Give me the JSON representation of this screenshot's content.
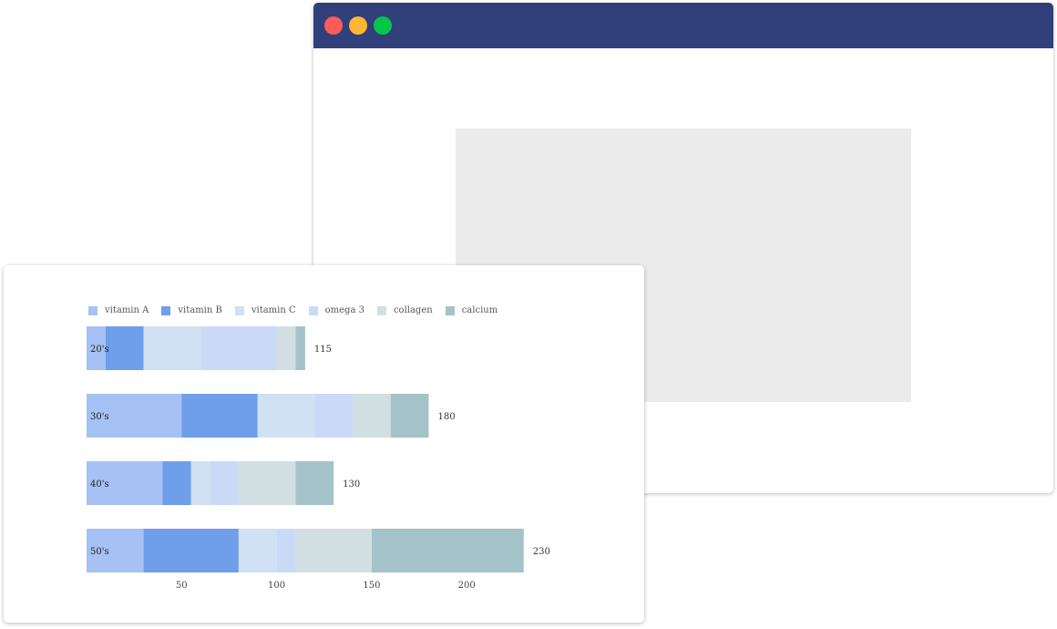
{
  "window": {
    "controls": [
      "close",
      "minimize",
      "maximize"
    ],
    "titlebar_color": "#313f7a"
  },
  "chart_data": {
    "type": "bar",
    "orientation": "horizontal",
    "stacked": true,
    "categories": [
      "20's",
      "30's",
      "40's",
      "50's"
    ],
    "series": [
      {
        "name": "vitamin A",
        "color": "#a6c1f3",
        "values": [
          10,
          50,
          40,
          30
        ]
      },
      {
        "name": "vitamin B",
        "color": "#6f9eea",
        "values": [
          20,
          40,
          15,
          50
        ]
      },
      {
        "name": "vitamin C",
        "color": "#cfe1f3",
        "values": [
          30,
          30,
          10,
          20
        ]
      },
      {
        "name": "omega 3",
        "color": "#c9daf7",
        "values": [
          40,
          20,
          15,
          10
        ]
      },
      {
        "name": "collagen",
        "color": "#d1dfe2",
        "values": [
          10,
          20,
          30,
          40
        ]
      },
      {
        "name": "calcium",
        "color": "#a4c3c8",
        "values": [
          5,
          20,
          20,
          80
        ]
      }
    ],
    "totals": [
      "115",
      "180",
      "130",
      "230"
    ],
    "x_ticks": [
      "50",
      "100",
      "150",
      "200"
    ],
    "xlim": [
      0,
      230
    ],
    "legend_position": "top-left",
    "grid": false
  }
}
